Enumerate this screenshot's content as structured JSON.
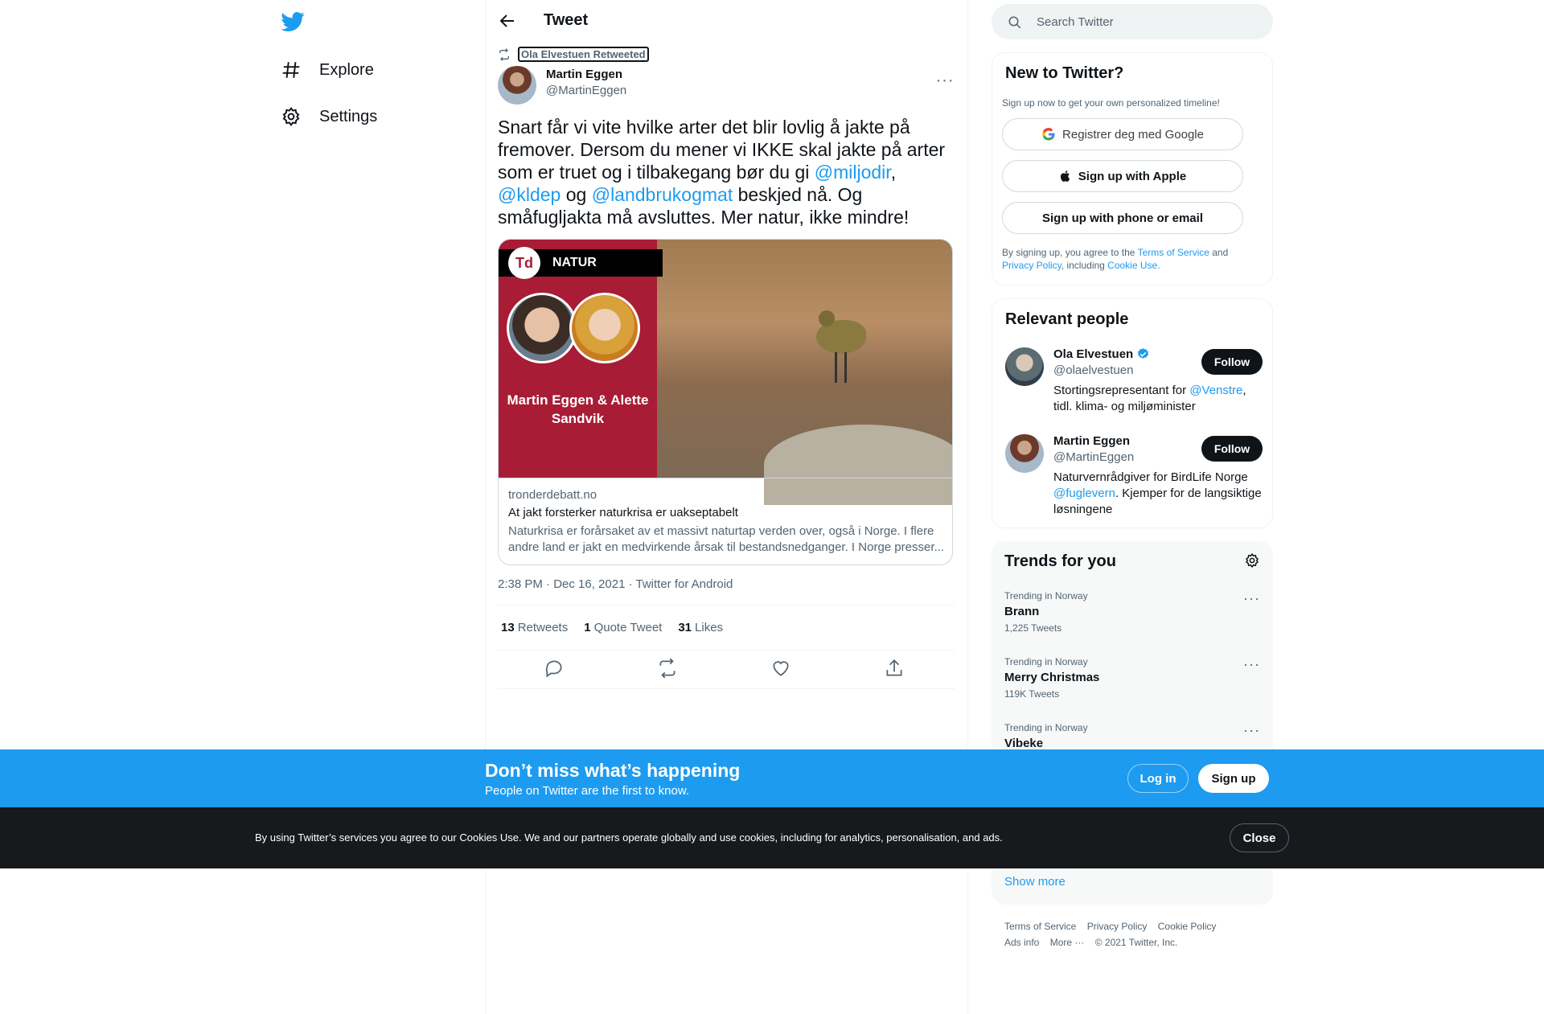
{
  "nav": {
    "items": [
      {
        "label": "Explore",
        "icon": "hashtag-icon"
      },
      {
        "label": "Settings",
        "icon": "gear-icon"
      }
    ]
  },
  "header": {
    "title": "Tweet"
  },
  "tweet": {
    "retweeted_by": "Ola Elvestuen Retweeted",
    "author_name": "Martin Eggen",
    "author_handle": "@MartinEggen",
    "text_parts": [
      "Snart får vi vite hvilke arter det blir lovlig å jakte på fremover. Dersom du mener vi IKKE skal jakte på arter som er truet og i tilbakegang bør du gi ",
      "@miljodir",
      ", ",
      "@kldep",
      " og ",
      "@landbrukogmat",
      " beskjed nå. Og småfugljakta må avsluttes. Mer natur, ikke mindre!"
    ],
    "card": {
      "badge_logo": "Td",
      "badge_label": "NATUR",
      "image_names": "Martin Eggen & Alette Sandvik",
      "domain": "tronderdebatt.no",
      "title": "At jakt forsterker naturkrisa er uakseptabelt",
      "description": "Naturkrisa er forårsaket av et massivt naturtap verden over, også i Norge. I flere andre land er jakt en medvirkende årsak til bestandsnedganger. I Norge presser..."
    },
    "meta": "2:38 PM · Dec 16, 2021 · Twitter for Android",
    "stats": [
      {
        "count": "13",
        "label": "Retweets"
      },
      {
        "count": "1",
        "label": "Quote Tweet"
      },
      {
        "count": "31",
        "label": "Likes"
      }
    ]
  },
  "search": {
    "placeholder": "Search Twitter"
  },
  "signup": {
    "title": "New to Twitter?",
    "subtitle": "Sign up now to get your own personalized timeline!",
    "google": "Registrer deg med Google",
    "apple": "Sign up with Apple",
    "phone": "Sign up with phone or email",
    "legal_prefix": "By signing up, you agree to the ",
    "legal_tos": "Terms of Service",
    "legal_and": " and ",
    "legal_privacy": "Privacy Policy",
    "legal_including": ", including ",
    "legal_cookie": "Cookie Use."
  },
  "relevant": {
    "title": "Relevant people",
    "people": [
      {
        "name": "Ola Elvestuen",
        "handle": "@olaelvestuen",
        "verified": true,
        "bio_pre": "Stortingsrepresentant for ",
        "bio_mention": "@Venstre",
        "bio_post": ", tidl. klima- og miljøminister",
        "follow": "Follow"
      },
      {
        "name": "Martin Eggen",
        "handle": "@MartinEggen",
        "verified": false,
        "bio_pre": "Naturvernrådgiver for BirdLife Norge ",
        "bio_mention": "@fuglevern",
        "bio_post": ". Kjemper for de langsiktige løsningene",
        "follow": "Follow"
      }
    ]
  },
  "trends": {
    "title": "Trends for you",
    "items": [
      {
        "context": "Trending in Norway",
        "name": "Brann",
        "count": "1,225 Tweets"
      },
      {
        "context": "Trending in Norway",
        "name": "Merry Christmas",
        "count": "119K Tweets"
      },
      {
        "context": "Trending in Norway",
        "name": "Vibeke",
        "count": ""
      }
    ],
    "show_more": "Show more"
  },
  "footer": {
    "links": [
      "Terms of Service",
      "Privacy Policy",
      "Cookie Policy",
      "Ads info",
      "More ···"
    ],
    "copyright": "© 2021 Twitter, Inc."
  },
  "banner": {
    "title": "Don’t miss what’s happening",
    "subtitle": "People on Twitter are the first to know.",
    "login": "Log in",
    "signup": "Sign up"
  },
  "cookies": {
    "text": "By using Twitter’s services you agree to our Cookies Use. We and our partners operate globally and use cookies, including for analytics, personalisation, and ads.",
    "close": "Close"
  },
  "colors": {
    "accent": "#1d9bf0",
    "text": "#0f1419",
    "muted": "#536471",
    "cookie_bg": "#17191c"
  }
}
